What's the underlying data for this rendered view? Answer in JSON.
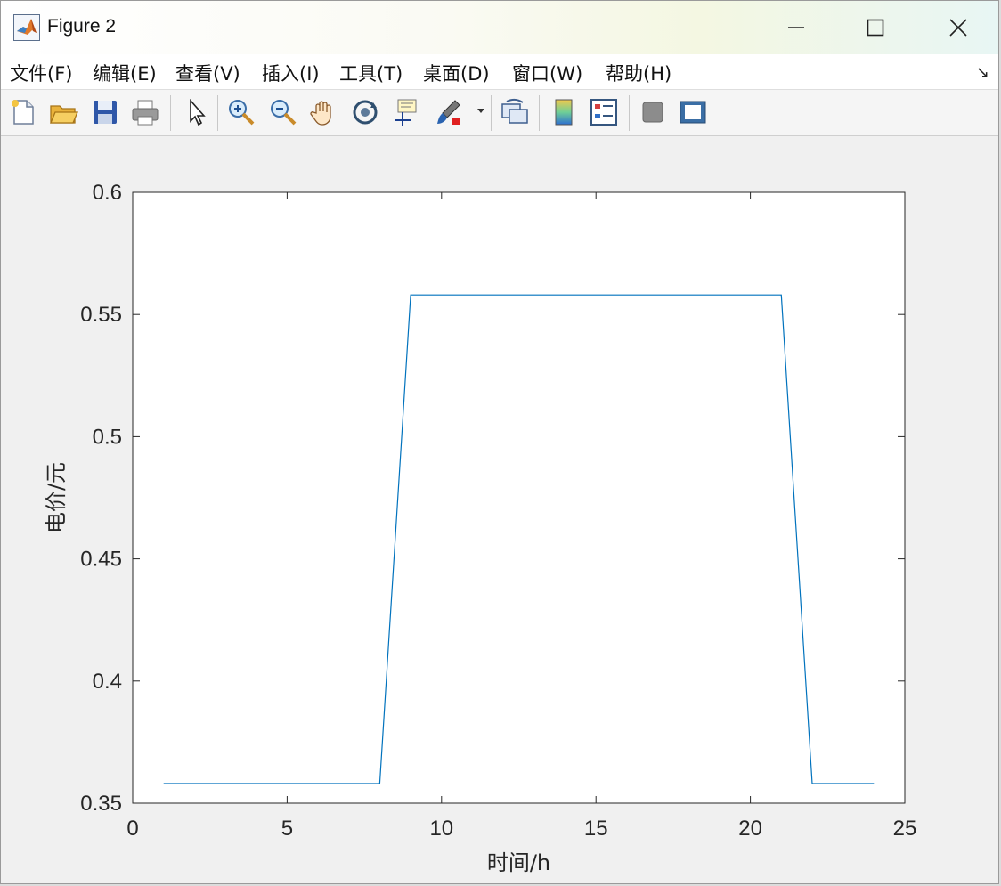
{
  "window": {
    "title": "Figure 2",
    "controls": {
      "minimize": "—",
      "maximize": "☐",
      "close": "✕"
    }
  },
  "menubar": {
    "items": [
      {
        "label": "文件(F)"
      },
      {
        "label": "编辑(E)"
      },
      {
        "label": "查看(V)"
      },
      {
        "label": "插入(I)"
      },
      {
        "label": "工具(T)"
      },
      {
        "label": "桌面(D)"
      },
      {
        "label": "窗口(W)"
      },
      {
        "label": "帮助(H)"
      }
    ],
    "more": "↘"
  },
  "toolbar": {
    "icons": [
      "new-figure-icon",
      "open-folder-icon",
      "save-icon",
      "print-icon",
      "pointer-icon",
      "zoom-in-icon",
      "zoom-out-icon",
      "pan-hand-icon",
      "rotate-3d-icon",
      "data-cursor-icon",
      "brush-icon",
      "link-plot-icon",
      "colorbar-icon",
      "legend-icon",
      "hide-plot-tools-icon",
      "show-plot-tools-icon"
    ]
  },
  "chart_data": {
    "type": "line",
    "title": "",
    "xlabel": "时间/h",
    "ylabel": "电价/元",
    "xlim": [
      0,
      25
    ],
    "ylim": [
      0.35,
      0.6
    ],
    "xticks": [
      0,
      5,
      10,
      15,
      20,
      25
    ],
    "yticks": [
      0.35,
      0.4,
      0.45,
      0.5,
      0.55,
      0.6
    ],
    "xtick_labels": [
      "0",
      "5",
      "10",
      "15",
      "20",
      "25"
    ],
    "ytick_labels": [
      "0.35",
      "0.4",
      "0.45",
      "0.5",
      "0.55",
      "0.6"
    ],
    "grid": false,
    "series": [
      {
        "color": "#0072bd",
        "x": [
          1,
          2,
          3,
          4,
          5,
          6,
          7,
          8,
          9,
          10,
          11,
          12,
          13,
          14,
          15,
          16,
          17,
          18,
          19,
          20,
          21,
          22,
          23,
          24
        ],
        "y": [
          0.358,
          0.358,
          0.358,
          0.358,
          0.358,
          0.358,
          0.358,
          0.358,
          0.558,
          0.558,
          0.558,
          0.558,
          0.558,
          0.558,
          0.558,
          0.558,
          0.558,
          0.558,
          0.558,
          0.558,
          0.558,
          0.358,
          0.358,
          0.358
        ]
      }
    ]
  }
}
